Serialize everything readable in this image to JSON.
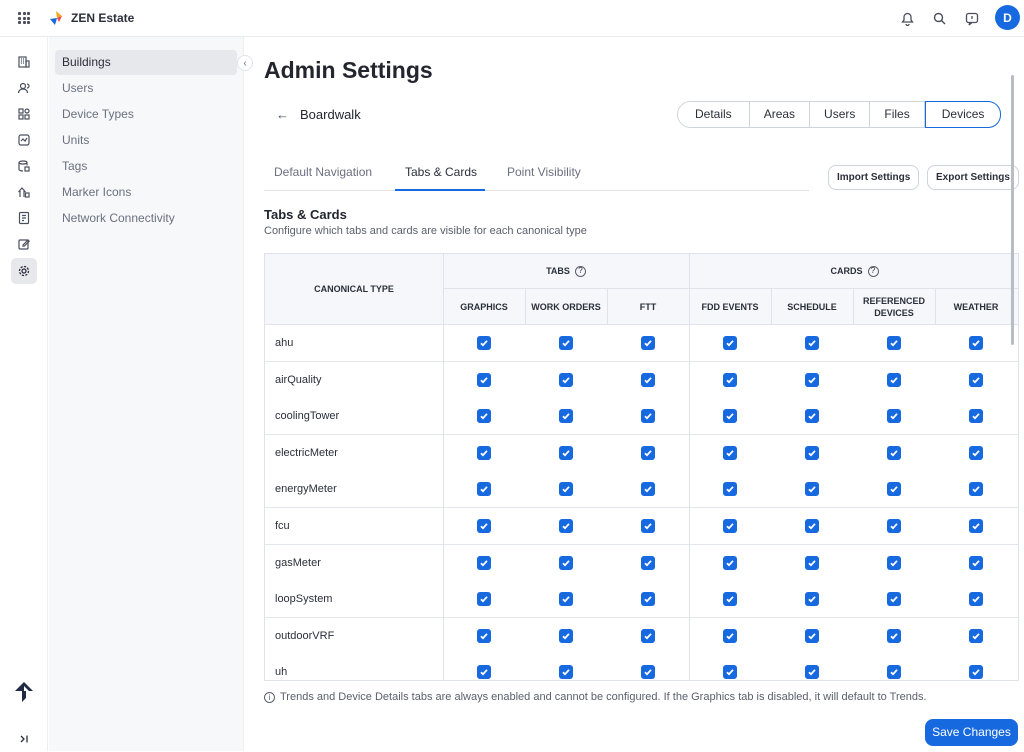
{
  "app": {
    "name": "ZEN Estate",
    "avatar_initial": "D",
    "accent": "#1769e0"
  },
  "rail": {
    "icons": [
      "building-icon",
      "users-icon",
      "device-types-icon",
      "units-icon",
      "tags-icon",
      "marker-icons-icon",
      "network-icon",
      "edit-icon",
      "settings-icon"
    ],
    "bottom": [
      "logo-icon",
      "expand-icon"
    ]
  },
  "sidebar": {
    "items": [
      {
        "label": "Buildings",
        "active": true
      },
      {
        "label": "Users"
      },
      {
        "label": "Device Types"
      },
      {
        "label": "Units"
      },
      {
        "label": "Tags"
      },
      {
        "label": "Marker Icons"
      },
      {
        "label": "Network Connectivity"
      }
    ]
  },
  "header": {
    "title": "Admin Settings",
    "building": "Boardwalk"
  },
  "segments": [
    "Details",
    "Areas",
    "Users",
    "Files",
    "Devices"
  ],
  "subtabs": [
    "Default Navigation",
    "Tabs & Cards",
    "Point Visibility"
  ],
  "actions": {
    "import": "Import Settings",
    "export": "Export Settings",
    "save": "Save Changes"
  },
  "section": {
    "title": "Tabs & Cards",
    "subtitle": "Configure which tabs and cards are visible for each canonical type"
  },
  "table": {
    "col_canonical": "CANONICAL TYPE",
    "group_tabs": "TABS",
    "group_cards": "CARDS",
    "columns": [
      "GRAPHICS",
      "WORK ORDERS",
      "FTT",
      "FDD EVENTS",
      "SCHEDULE",
      "REFERENCED DEVICES",
      "WEATHER"
    ],
    "rows": [
      "ahu",
      "airQuality",
      "coolingTower",
      "electricMeter",
      "energyMeter",
      "fcu",
      "gasMeter",
      "loopSystem",
      "outdoorVRF",
      "uh"
    ]
  },
  "footnote": "Trends and Device Details tabs are always enabled and cannot be configured. If the Graphics tab is disabled, it will default to Trends."
}
